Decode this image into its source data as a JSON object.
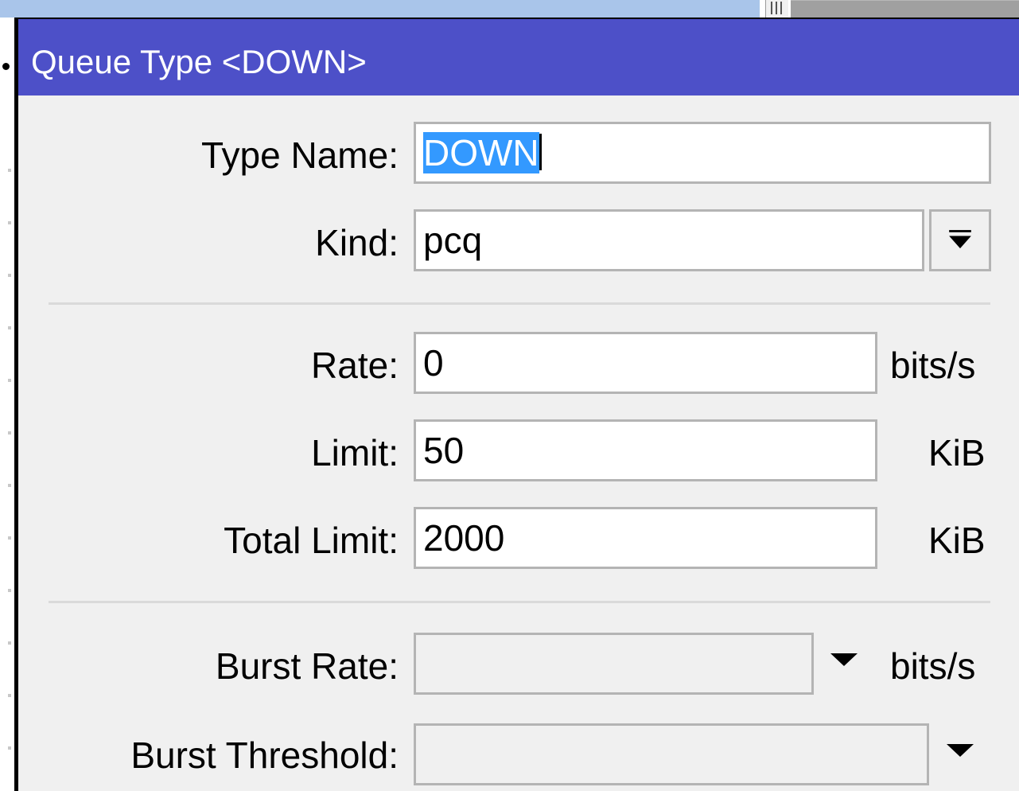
{
  "window": {
    "title": "Queue Type <DOWN>"
  },
  "form": {
    "type_name": {
      "label": "Type Name:",
      "value": "DOWN"
    },
    "kind": {
      "label": "Kind:",
      "value": "pcq",
      "dropdown_icon": "bar-down-arrow-icon"
    },
    "rate": {
      "label": "Rate:",
      "value": "0",
      "unit": "bits/s"
    },
    "limit": {
      "label": "Limit:",
      "value": "50",
      "unit": "KiB"
    },
    "total_limit": {
      "label": "Total Limit:",
      "value": "2000",
      "unit": "KiB"
    },
    "burst_rate": {
      "label": "Burst Rate:",
      "value": "",
      "unit": "bits/s",
      "dropdown_icon": "triangle-down-icon"
    },
    "burst_threshold": {
      "label": "Burst Threshold:",
      "value": "",
      "dropdown_icon": "triangle-down-icon"
    }
  },
  "colors": {
    "titlebar": "#4d50c8",
    "selection": "#3399ff",
    "dialog_bg": "#f0f0f0",
    "field_border": "#b4b4b4"
  }
}
